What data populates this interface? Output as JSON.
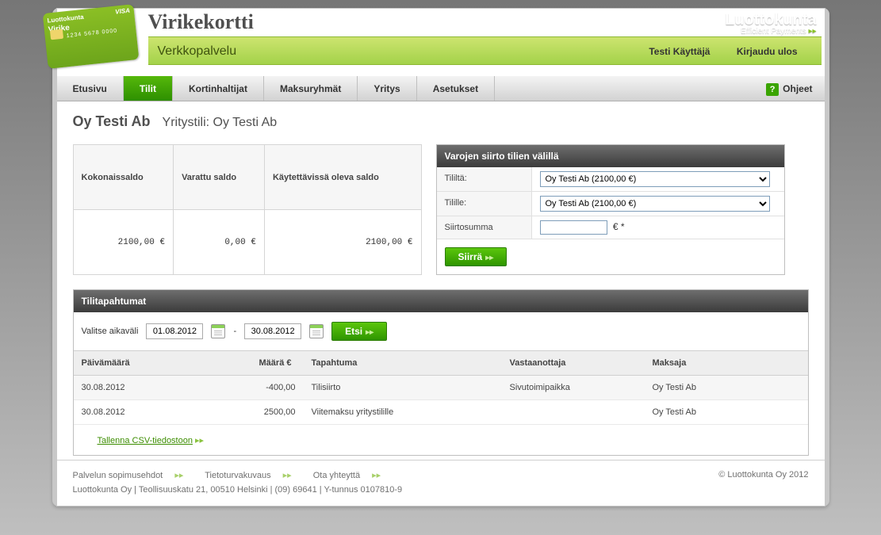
{
  "brand": {
    "app_name": "Virikekortti",
    "service": "Verkkopalvelu",
    "card_brand": "Luottokunta",
    "card_product": "Virike",
    "card_visa": "VISA",
    "card_num": "1234 5678 0000"
  },
  "logo": {
    "line1": "Luottokunta",
    "line2": "Efficient Payments"
  },
  "user_bar": {
    "user": "Testi Käyttäjä",
    "logout": "Kirjaudu ulos"
  },
  "nav": {
    "items": [
      "Etusivu",
      "Tilit",
      "Kortinhaltijat",
      "Maksuryhmät",
      "Yritys",
      "Asetukset"
    ],
    "active_index": 1,
    "help": "Ohjeet"
  },
  "page": {
    "company": "Oy Testi Ab",
    "account_label": "Yritystili: Oy Testi Ab"
  },
  "balance": {
    "headers": [
      "Kokonaissaldo",
      "Varattu saldo",
      "Käytettävissä oleva saldo"
    ],
    "values": [
      "2100,00 €",
      "0,00 €",
      "2100,00 €"
    ]
  },
  "transfer": {
    "title": "Varojen siirto tilien välillä",
    "from_label": "Tililtä:",
    "to_label": "Tilille:",
    "amount_label": "Siirtosumma",
    "account_option": "Oy Testi Ab (2100,00 €)",
    "amount_value": "",
    "currency": "€ *",
    "button": "Siirrä"
  },
  "transactions": {
    "title": "Tilitapahtumat",
    "filter_label": "Valitse aikaväli",
    "date_from": "01.08.2012",
    "date_to": "30.08.2012",
    "search_button": "Etsi",
    "headers": [
      "Päivämäärä",
      "Määrä €",
      "Tapahtuma",
      "Vastaanottaja",
      "Maksaja"
    ],
    "rows": [
      {
        "date": "30.08.2012",
        "amount": "-400,00",
        "event": "Tilisiirto",
        "receiver": "Sivutoimipaikka",
        "payer": "Oy Testi Ab"
      },
      {
        "date": "30.08.2012",
        "amount": "2500,00",
        "event": "Viitemaksu yritystilille",
        "receiver": "",
        "payer": "Oy Testi Ab"
      }
    ],
    "csv_link": "Tallenna CSV-tiedostoon"
  },
  "footer": {
    "links": [
      "Palvelun sopimusehdot",
      "Tietoturvakuvaus",
      "Ota yhteyttä"
    ],
    "copyright": "© Luottokunta Oy 2012",
    "address": "Luottokunta Oy | Teollisuuskatu 21, 00510 Helsinki | (09) 69641 | Y-tunnus 0107810-9"
  }
}
